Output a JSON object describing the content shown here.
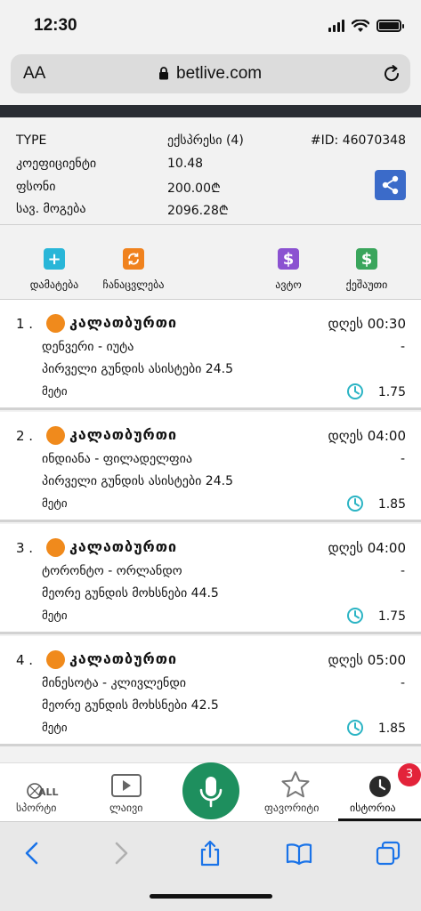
{
  "status_bar": {
    "time": "12:30"
  },
  "browser": {
    "text_size_label": "AA",
    "url": "betlive.com"
  },
  "info": {
    "type_label": "TYPE",
    "type_value": "ექსპრესი (4)",
    "id_label": "#ID: 46070348",
    "coef_label": "კოეფიციენტი",
    "coef_value": "10.48",
    "stake_label": "ფსონი",
    "stake_value": "200.00₾",
    "win_label": "სავ. მოგება",
    "win_value": "2096.28₾"
  },
  "actions": {
    "add": "დამატება",
    "replace": "ჩანაცვლება",
    "auto": "ავტო",
    "cashout": "ქეშაუთი",
    "colors": {
      "add": "#29b6d8",
      "replace": "#f0821e",
      "auto": "#8b52d1",
      "cashout": "#3aa55c"
    }
  },
  "bets": [
    {
      "num": "1 .",
      "sport": "კალათბურთი",
      "time": "დღეს 00:30",
      "dash": "-",
      "match": "დენვერი - იუტა",
      "market": "პირველი გუნდის ასისტები 24.5",
      "pick": "მეტი",
      "odds": "1.75"
    },
    {
      "num": "2 .",
      "sport": "კალათბურთი",
      "time": "დღეს 04:00",
      "dash": "-",
      "match": "ინდიანა - ფილადელფია",
      "market": "პირველი გუნდის ასისტები 24.5",
      "pick": "მეტი",
      "odds": "1.85"
    },
    {
      "num": "3 .",
      "sport": "კალათბურთი",
      "time": "დღეს 04:00",
      "dash": "-",
      "match": "ტორონტო - ორლანდო",
      "market": "მეორე გუნდის მოხსნები 44.5",
      "pick": "მეტი",
      "odds": "1.75"
    },
    {
      "num": "4 .",
      "sport": "კალათბურთი",
      "time": "დღეს 05:00",
      "dash": "-",
      "match": "მინესოტა - კლივლენდი",
      "market": "მეორე გუნდის მოხსნები 42.5",
      "pick": "მეტი",
      "odds": "1.85"
    }
  ],
  "bottom_nav": {
    "sports": "სპორტი",
    "sports_icon_text": "ALL",
    "live": "ლაივი",
    "favorites": "ფავორიტი",
    "history": "ისტორია",
    "history_badge": "3"
  },
  "colors": {
    "accent_green": "#1e8f5e",
    "share_blue": "#3b6bc9",
    "badge_red": "#e3233a",
    "clock_teal": "#2bb4c4"
  }
}
